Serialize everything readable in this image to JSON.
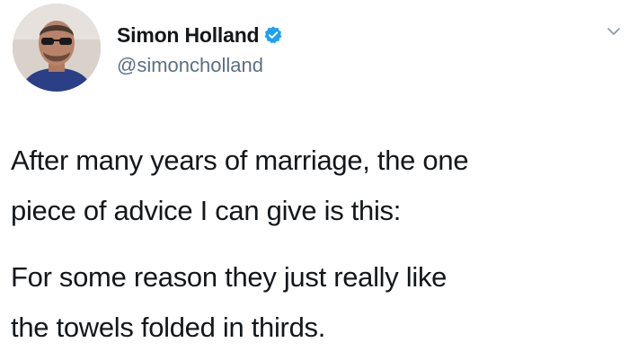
{
  "user": {
    "display_name": "Simon Holland",
    "handle": "@simoncholland",
    "verified": true,
    "verified_color": "#1da1f2",
    "avatar_icon": "user-avatar-photo"
  },
  "tweet": {
    "paragraph1": [
      "After many years of marriage, the one",
      "piece of advice I can give is this:"
    ],
    "paragraph2": [
      "For some reason they just really like",
      "the towels folded in thirds."
    ]
  },
  "icons": {
    "more": "chevron-down-icon",
    "verified": "verified-badge-icon"
  }
}
